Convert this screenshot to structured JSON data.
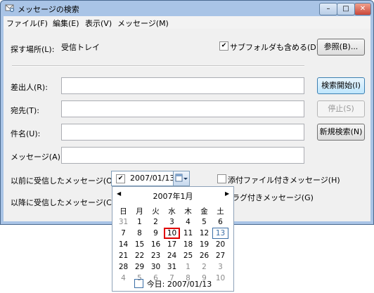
{
  "window": {
    "title": "メッセージの検索"
  },
  "menu": {
    "items": [
      "ファイル(F)",
      "編集(E)",
      "表示(V)",
      "メッセージ(M)"
    ]
  },
  "search_location": {
    "label": "探す場所(L):",
    "value": "受信トレイ",
    "include_subfolders": "サブフォルダも含める(D)",
    "browse": "参照(B)..."
  },
  "fields": {
    "from": {
      "label": "差出人(R):",
      "value": ""
    },
    "to": {
      "label": "宛先(T):",
      "value": ""
    },
    "subject": {
      "label": "件名(U):",
      "value": ""
    },
    "message": {
      "label": "メッセージ(A):",
      "value": ""
    }
  },
  "buttons": {
    "find_now": "検索開始(I)",
    "stop": "停止(S)",
    "new_search": "新規検索(N)"
  },
  "received_before": {
    "label": "以前に受信したメッセージ(O):",
    "date": "2007/01/13",
    "checked": true
  },
  "received_after": {
    "label": "以降に受信したメッセージ(C):"
  },
  "options": {
    "has_attachment": "添付ファイル付きメッセージ(H)",
    "flagged": "ラグ付きメッセージ(G)"
  },
  "calendar": {
    "month_title": "2007年1月",
    "weekdays": [
      "日",
      "月",
      "火",
      "水",
      "木",
      "金",
      "土"
    ],
    "weeks": [
      [
        "31",
        "1",
        "2",
        "3",
        "4",
        "5",
        "6"
      ],
      [
        "7",
        "8",
        "9",
        "10",
        "11",
        "12",
        "13"
      ],
      [
        "14",
        "15",
        "16",
        "17",
        "18",
        "19",
        "20"
      ],
      [
        "21",
        "22",
        "23",
        "24",
        "25",
        "26",
        "27"
      ],
      [
        "28",
        "29",
        "30",
        "31",
        "1",
        "2",
        "3"
      ],
      [
        "4",
        "5",
        "6",
        "7",
        "8",
        "9",
        "10"
      ]
    ],
    "today_label": "今日: 2007/01/13",
    "selected_day": "10",
    "today_day": "13",
    "colors": {
      "selection": "#e00000",
      "today": "#3a6ea5"
    }
  }
}
